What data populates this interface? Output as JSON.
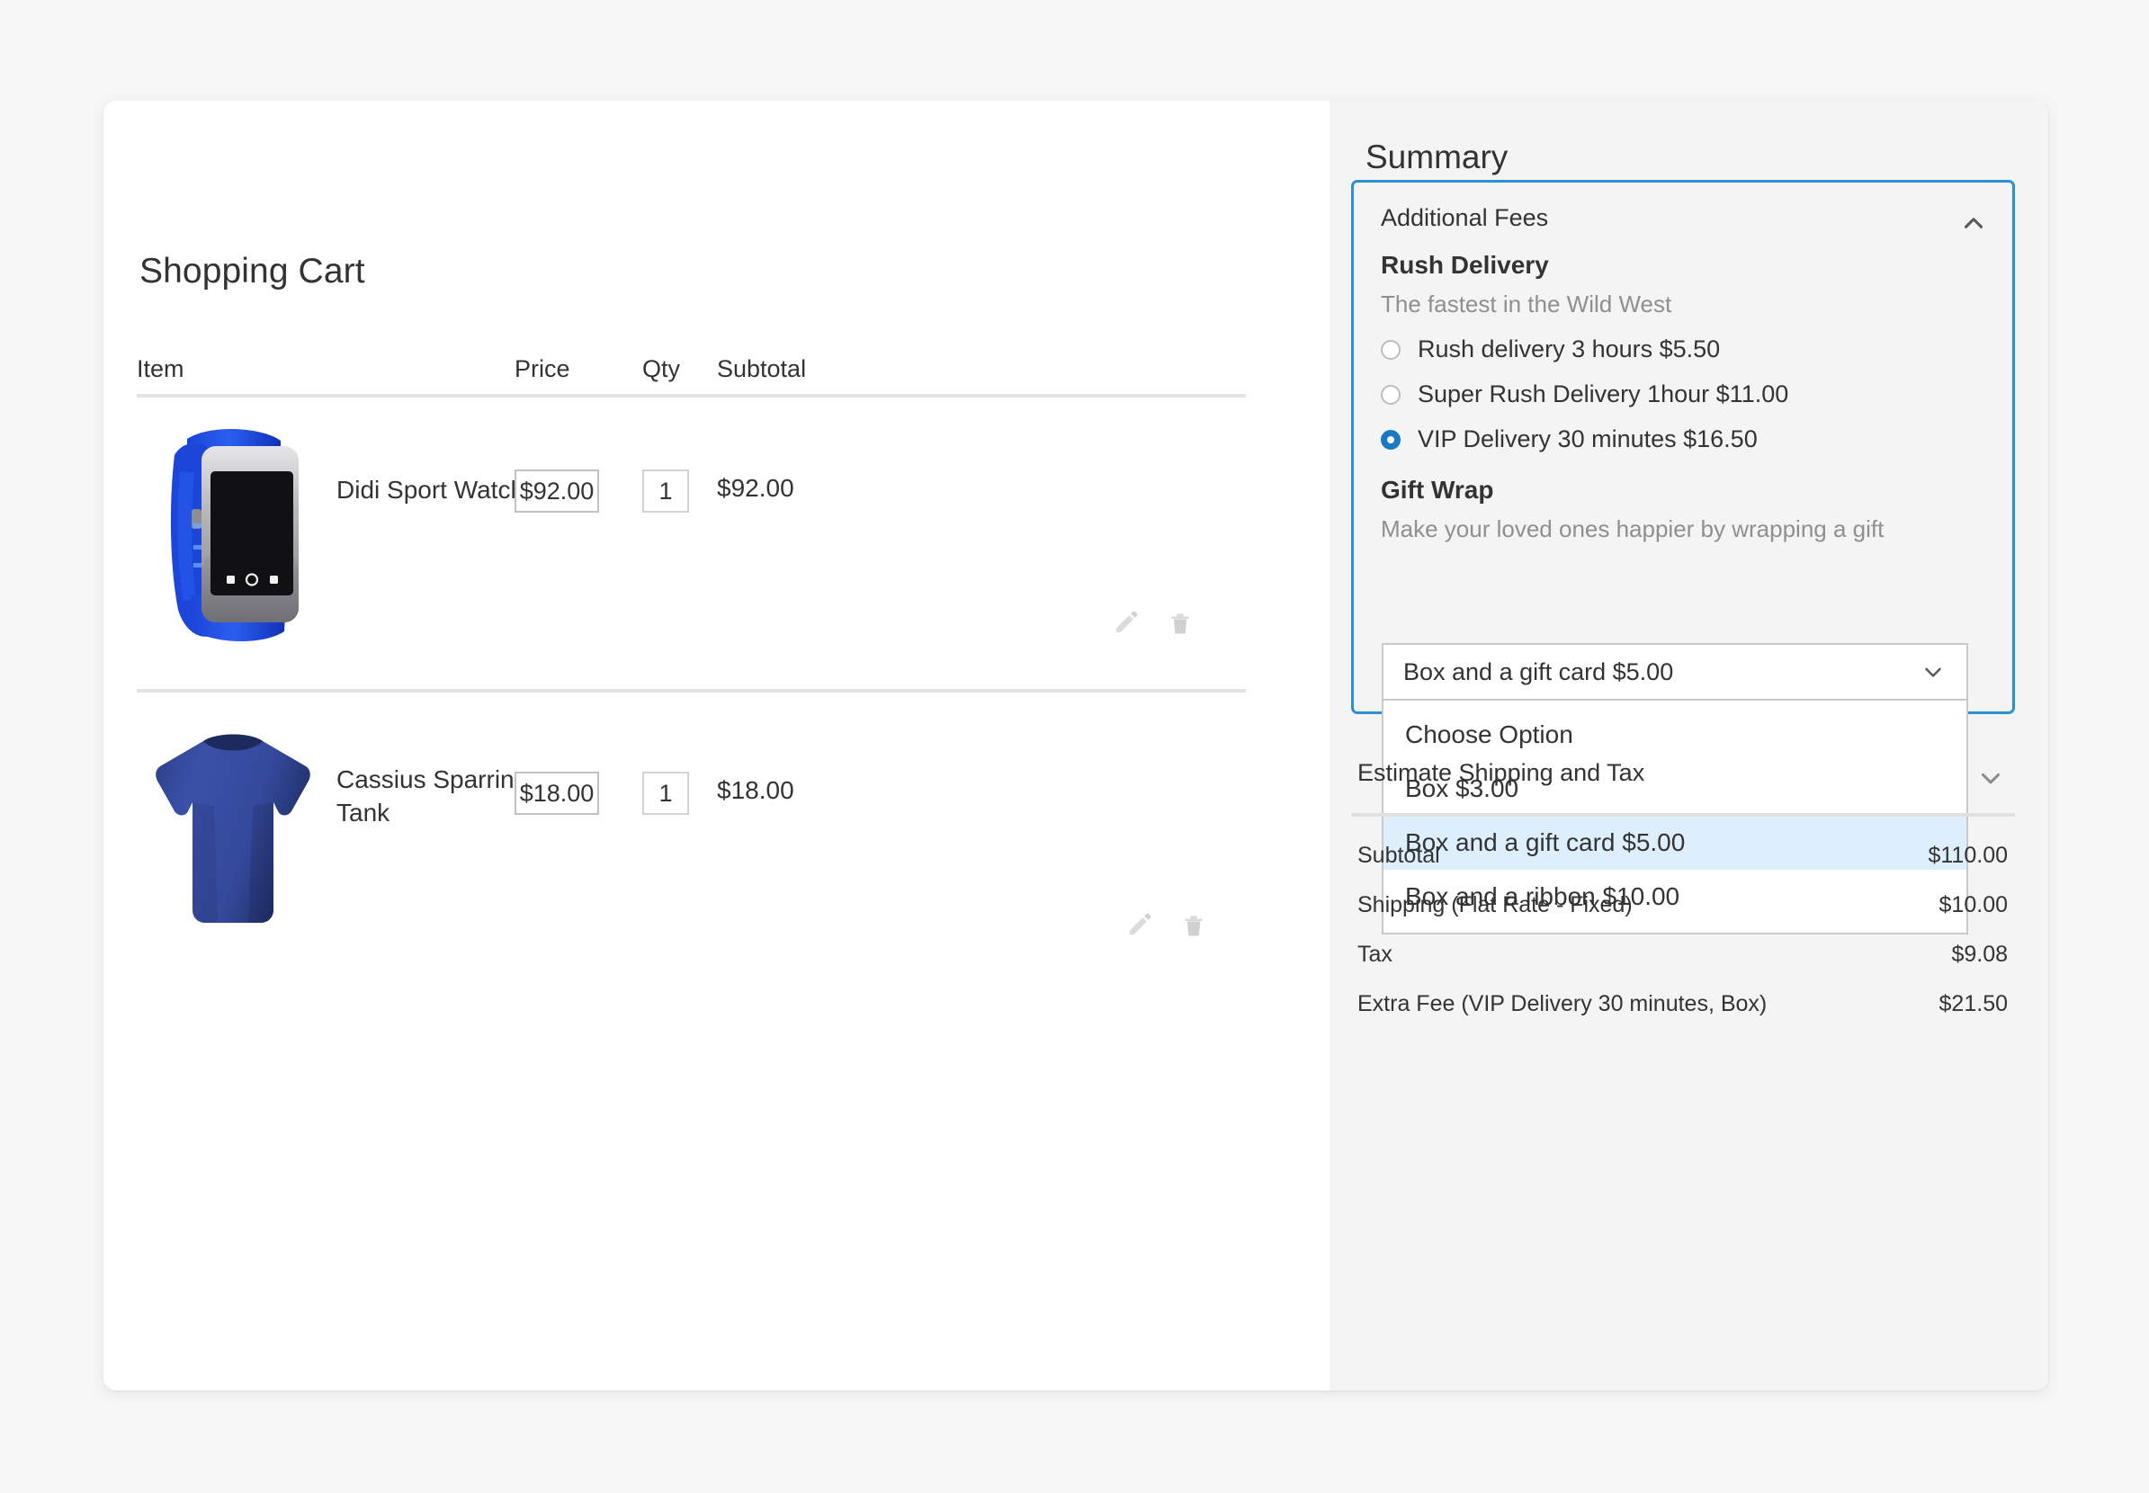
{
  "cart": {
    "title": "Shopping Cart",
    "columns": [
      "Item",
      "Price",
      "Qty",
      "Subtotal"
    ],
    "items": [
      {
        "name": "Didi Sport Watch",
        "price": "$92.00",
        "qty": "1",
        "subtotal": "$92.00",
        "image": "smart-watch-blue"
      },
      {
        "name": "Cassius Sparring Tank",
        "price": "$18.00",
        "qty": "1",
        "subtotal": "$18.00",
        "image": "t-shirt-navy"
      }
    ],
    "row_actions": {
      "edit_icon": "pencil-icon",
      "delete_icon": "trash-icon"
    }
  },
  "summary": {
    "title": "Summary",
    "additional_fees": {
      "header": "Additional Fees",
      "collapse_icon": "chevron-up-icon",
      "rush_delivery": {
        "title": "Rush Delivery",
        "subtitle": "The fastest in the Wild West",
        "options": [
          {
            "label": "Rush delivery 3 hours $5.50",
            "selected": false
          },
          {
            "label": "Super Rush Delivery 1hour $11.00",
            "selected": false
          },
          {
            "label": "VIP Delivery 30 minutes $16.50",
            "selected": true
          }
        ]
      },
      "gift_wrap": {
        "title": "Gift Wrap",
        "subtitle": "Make your loved ones happier by wrapping a gift",
        "selected_value": "Box and a gift card $5.00",
        "dropdown_icon": "chevron-down-icon",
        "options": [
          {
            "label": "Choose Option",
            "selected": false
          },
          {
            "label": "Box $3.00",
            "selected": false
          },
          {
            "label": "Box and a gift card $5.00",
            "selected": true
          },
          {
            "label": "Box and a ribbon $10.00",
            "selected": false
          }
        ]
      }
    },
    "estimate_shipping": {
      "label": "Estimate Shipping and Tax",
      "expand_icon": "chevron-down-icon"
    },
    "totals": [
      {
        "label": "Subtotal",
        "value": "$110.00"
      },
      {
        "label": "Shipping (Flat Rate - Fixed)",
        "value": "$10.00"
      },
      {
        "label": "Tax",
        "value": "$9.08"
      },
      {
        "label": "Extra Fee (VIP Delivery 30 minutes, Box)",
        "value": "$21.50"
      }
    ]
  },
  "colors": {
    "accent_blue": "#1979c3",
    "focus_border": "#2a8fd4",
    "option_highlight": "#ddeefc",
    "page_bg": "#f6f6f6",
    "summary_bg": "#f4f4f4",
    "text": "#333333",
    "muted_text": "#8f8f8f"
  }
}
